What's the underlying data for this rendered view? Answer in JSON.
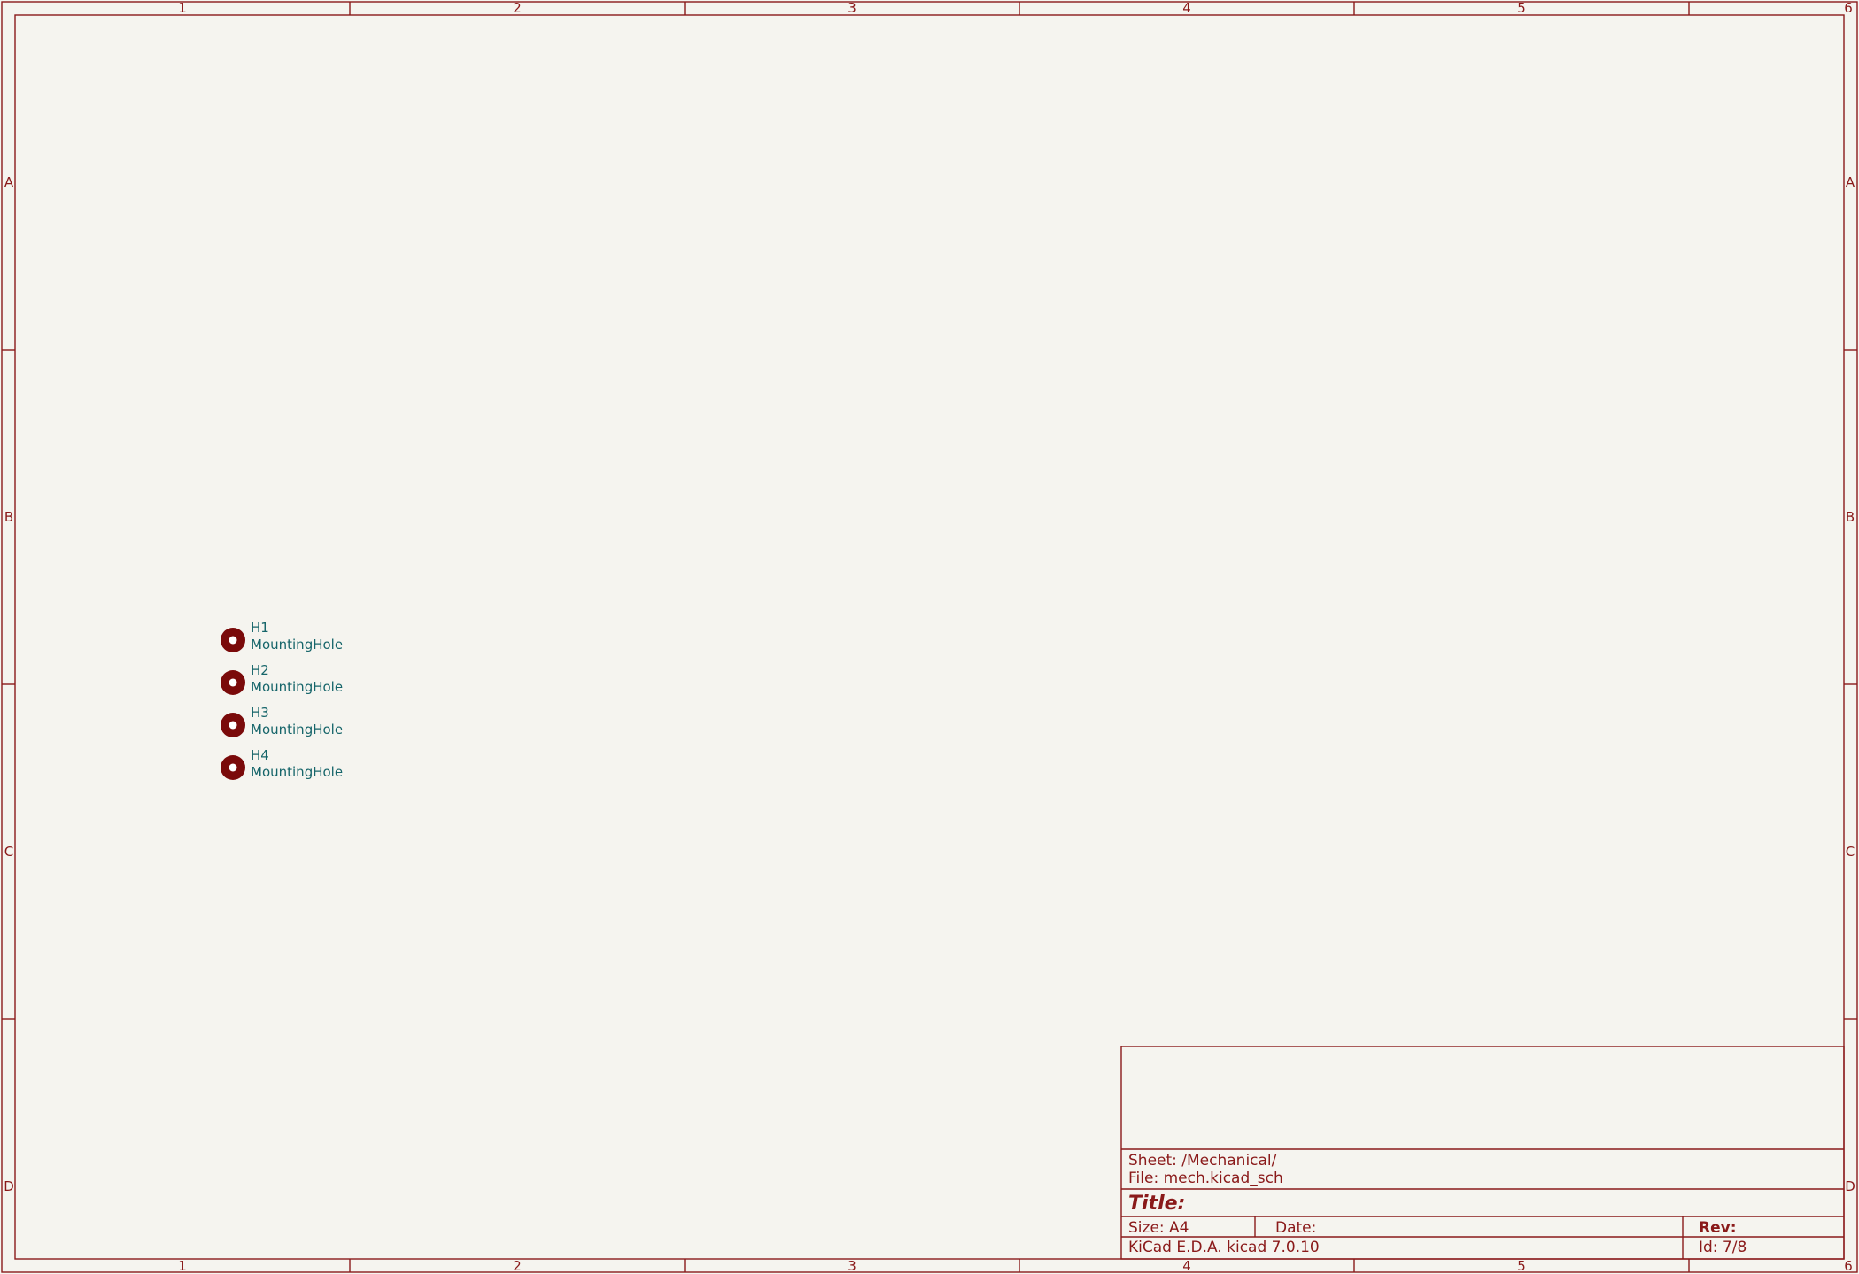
{
  "frame": {
    "columns": [
      "1",
      "2",
      "3",
      "4",
      "5",
      "6"
    ],
    "rows": [
      "A",
      "B",
      "C",
      "D"
    ],
    "color": "#8a1a1a"
  },
  "symbols": [
    {
      "reference": "H1",
      "value": "MountingHole"
    },
    {
      "reference": "H2",
      "value": "MountingHole"
    },
    {
      "reference": "H3",
      "value": "MountingHole"
    },
    {
      "reference": "H4",
      "value": "MountingHole"
    }
  ],
  "title_block": {
    "sheet": "Sheet: /Mechanical/",
    "file": "File: mech.kicad_sch",
    "title_label": "Title:",
    "size": "Size: A4",
    "date_label": "Date:",
    "rev_label": "Rev:",
    "generator": "KiCad E.D.A.  kicad 7.0.10",
    "id": "Id: 7/8"
  },
  "colors": {
    "background": "#f5f4ef",
    "frame": "#8a1a1a",
    "symbol": "#7a0a0a",
    "field_text": "#16656a"
  }
}
